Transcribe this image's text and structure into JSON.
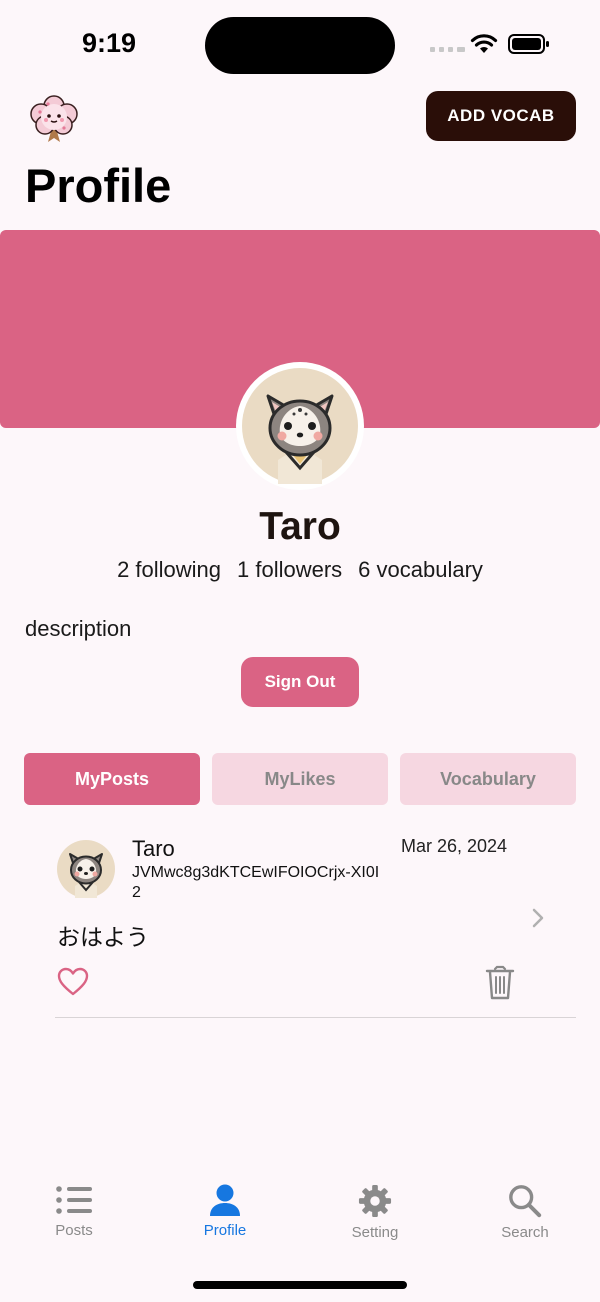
{
  "status_bar": {
    "time": "9:19",
    "icons": [
      "signal-icon",
      "wifi-icon",
      "battery-icon"
    ]
  },
  "header": {
    "logo": "sakura-mascot-logo",
    "add_vocab_label": "ADD VOCAB",
    "title": "Profile"
  },
  "colors": {
    "accent": "#da6384",
    "accent_light": "#f6d7e1",
    "dark_button": "#2a0e08",
    "background": "#fdf7fa",
    "nav_active": "#1677e0",
    "nav_inactive": "#8a8a8a"
  },
  "profile": {
    "avatar": "husky-avatar",
    "name": "Taro",
    "following": "2 following",
    "followers": "1 followers",
    "vocabulary": "6 vocabulary",
    "description": "description",
    "sign_out_label": "Sign Out"
  },
  "tabs": [
    {
      "label": "MyPosts",
      "active": true
    },
    {
      "label": "MyLikes",
      "active": false
    },
    {
      "label": "Vocabulary",
      "active": false
    }
  ],
  "posts": [
    {
      "user": "Taro",
      "user_id": "JVMwc8g3dKTCEwIFOIOCrjx-XI0I2",
      "date": "Mar 26, 2024",
      "text": "おはよう",
      "icons": [
        "heart-icon",
        "trash-icon",
        "chevron-right-icon"
      ]
    }
  ],
  "bottom_nav": [
    {
      "label": "Posts",
      "icon": "list-icon",
      "active": false
    },
    {
      "label": "Profile",
      "icon": "person-icon",
      "active": true
    },
    {
      "label": "Setting",
      "icon": "gear-icon",
      "active": false
    },
    {
      "label": "Search",
      "icon": "search-icon",
      "active": false
    }
  ]
}
